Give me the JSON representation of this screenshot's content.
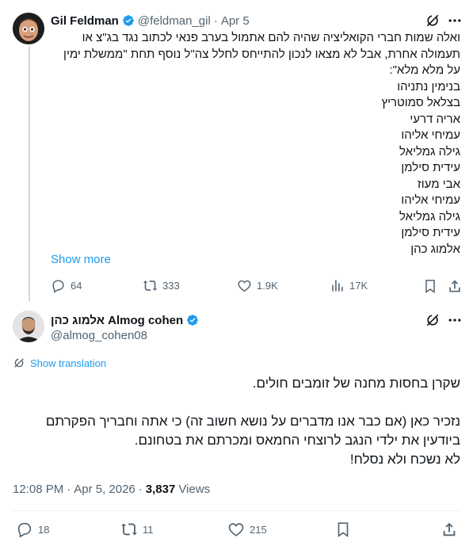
{
  "quoted_tweet": {
    "author_name": "Gil Feldman",
    "handle": "@feldman_gil",
    "separator": "·",
    "date": "Apr 5",
    "lines": [
      "ואלה שמות חברי הקואליציה שהיה להם אתמול בערב פנאי לכתוב נגד בג\"צ או",
      "תעמולה אחרת, אבל לא מצאו לנכון להתייחס לחלל צה\"ל נוסף תחת \"ממשלת ימין",
      "על מלא מלא\":",
      "בנימין נתניהו",
      "בצלאל סמוטריץ",
      "אריה דרעי",
      "עמיחי אליהו",
      "גילה גמליאל",
      "עידית סילמן",
      "אבי מעוז",
      "עמיחי אליהו",
      "גילה גמליאל",
      "עידית סילמן",
      "אלמוג כהן"
    ],
    "show_more": "Show more",
    "replies": "64",
    "reposts": "333",
    "likes": "1.9K",
    "views": "17K"
  },
  "main_tweet": {
    "author_name": "אלמוג כהן Almog cohen",
    "handle": "@almog_cohen08",
    "show_translation": "Show translation",
    "lines": [
      "שקרן בחסות מחנה של זומבים חולים.",
      "",
      "נזכיר כאן (אם כבר אנו מדברים על נושא חשוב זה) כי אתה וחבריך הפקרתם",
      "ביודעין את ילדי הנגב לרוצחי החמאס ומכרתם את בטחונם.",
      "לא נשכח ולא נסלח!"
    ],
    "time": "12:08 PM",
    "separator": "·",
    "date": "Apr 5, 2026",
    "view_count": "3,837",
    "views_label": "Views",
    "replies": "18",
    "reposts": "11",
    "likes": "215"
  },
  "colors": {
    "verified": "#1d9bf0",
    "link": "#1d9bf0",
    "muted": "#536471"
  }
}
